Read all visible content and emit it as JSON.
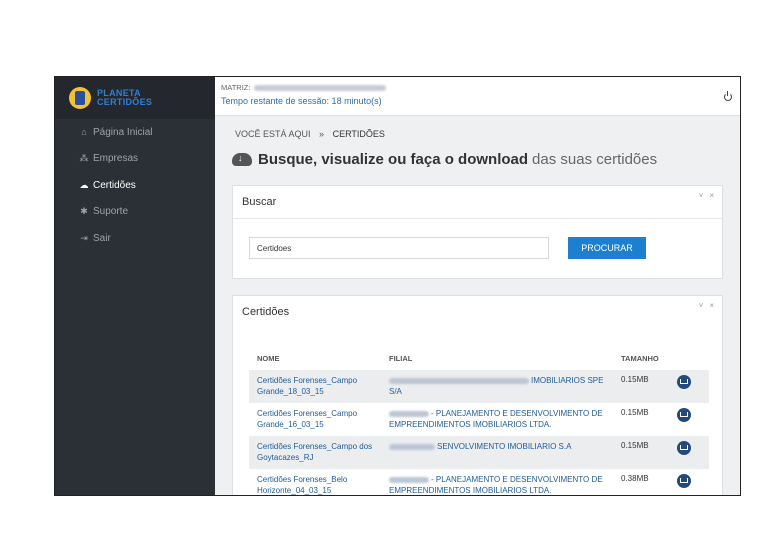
{
  "brand": {
    "line1": "PLANETA",
    "line2": "CERTIDÕES"
  },
  "sidebar": {
    "items": [
      {
        "label": "Página Inicial",
        "icon": "home-icon",
        "glyph": "⌂"
      },
      {
        "label": "Empresas",
        "icon": "sitemap-icon",
        "glyph": "⁂"
      },
      {
        "label": "Certidões",
        "icon": "cloud-download-icon",
        "glyph": "☁"
      },
      {
        "label": "Suporte",
        "icon": "support-icon",
        "glyph": "✱"
      },
      {
        "label": "Sair",
        "icon": "sign-out-icon",
        "glyph": "⇥"
      }
    ],
    "active_index": 2
  },
  "topbar": {
    "matriz_label": "MATRIZ:",
    "session": "Tempo restante de sessão: 18 minuto(s)"
  },
  "breadcrumb": {
    "prefix": "VOCÊ ESTÁ AQUI",
    "separator": "»",
    "current": "CERTIDÕES"
  },
  "heading": {
    "bold": "Busque, visualize ou faça o download",
    "rest": "das suas certidões"
  },
  "search": {
    "title": "Buscar",
    "value": "Certidoes",
    "button": "PROCURAR",
    "tools": {
      "collapse": "˅",
      "close": "×"
    }
  },
  "list": {
    "title": "Certidões",
    "tools": {
      "collapse": "˅",
      "close": "×"
    },
    "columns": {
      "name": "NOME",
      "filial": "FILIAL",
      "size": "TAMANHO"
    },
    "rows": [
      {
        "name": "Certidões Forenses_Campo Grande_18_03_15",
        "filial": "IMOBILIARIOS SPE S/A",
        "size": "0.15MB"
      },
      {
        "name": "Certidões Forenses_Campo Grande_16_03_15",
        "filial": "- PLANEJAMENTO E DESENVOLVIMENTO DE EMPREENDIMENTOS IMOBILIARIOS LTDA.",
        "size": "0.15MB"
      },
      {
        "name": "Certidões Forenses_Campo dos Goytacazes_RJ",
        "filial": "SENVOLVIMENTO IMOBILIARIO S.A",
        "size": "0.15MB"
      },
      {
        "name": "Certidões Forenses_Belo Horizonte_04_03_15",
        "filial": "- PLANEJAMENTO E DESENVOLVIMENTO DE EMPREENDIMENTOS IMOBILIARIOS LTDA.",
        "size": "0.38MB"
      }
    ]
  }
}
